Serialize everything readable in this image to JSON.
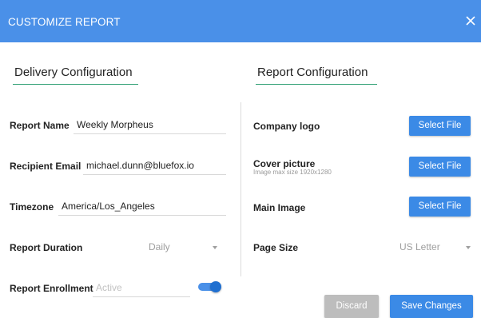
{
  "header": {
    "title": "CUSTOMIZE REPORT",
    "close_icon": "close-icon"
  },
  "delivery": {
    "title": "Delivery Configuration",
    "report_name_label": "Report Name",
    "report_name_value": "Weekly Morpheus",
    "recipient_email_label": "Recipient Email",
    "recipient_email_value": "michael.dunn@bluefox.io",
    "timezone_label": "Timezone",
    "timezone_value": "America/Los_Angeles",
    "report_duration_label": "Report Duration",
    "report_duration_value": "Daily",
    "report_enrollment_label": "Report Enrollment",
    "report_enrollment_placeholder": "Active",
    "report_enrollment_on": true
  },
  "report": {
    "title": "Report Configuration",
    "company_logo_label": "Company logo",
    "cover_picture_label": "Cover picture",
    "cover_picture_note": "Image max size 1920x1280",
    "main_image_label": "Main Image",
    "page_size_label": "Page Size",
    "page_size_value": "US Letter",
    "select_file_label": "Select File"
  },
  "footer": {
    "discard_label": "Discard",
    "save_label": "Save Changes"
  },
  "colors": {
    "header": "#4a90e8",
    "primary_button": "#3b8ae6",
    "disabled_button": "#bdbdbd",
    "underline": "#2e9e72"
  }
}
